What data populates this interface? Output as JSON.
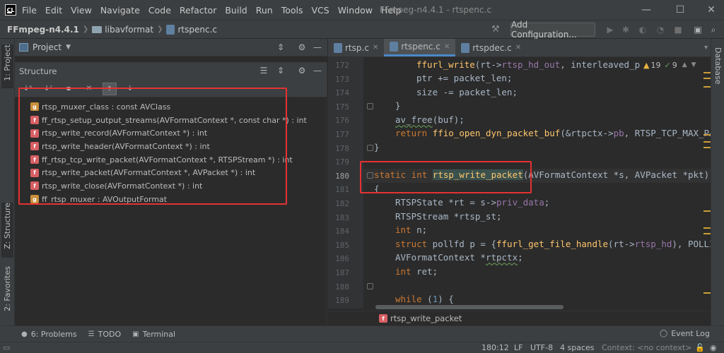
{
  "app": {
    "logo": "CL",
    "window_title": "FFmpeg-n4.4.1 - rtspenc.c",
    "menu": [
      "File",
      "Edit",
      "View",
      "Navigate",
      "Code",
      "Refactor",
      "Build",
      "Run",
      "Tools",
      "VCS",
      "Window",
      "Help"
    ]
  },
  "nav": {
    "project": "FFmpeg-n4.4.1",
    "folder": "libavformat",
    "file": "rtspenc.c",
    "config_button": "Add Configuration..."
  },
  "left_tools": {
    "project_tab": "1: Project",
    "structure_tab": "Z: Structure",
    "favorites_tab": "2: Favorites"
  },
  "right_tools": {
    "database_tab": "Database"
  },
  "project_panel": {
    "title": "Project"
  },
  "structure": {
    "title": "Structure",
    "items": [
      {
        "badge": "g",
        "label": "rtsp_muxer_class : const AVClass"
      },
      {
        "badge": "f",
        "label": "ff_rtsp_setup_output_streams(AVFormatContext *, const char *) : int"
      },
      {
        "badge": "f",
        "label": "rtsp_write_record(AVFormatContext *) : int"
      },
      {
        "badge": "f",
        "label": "rtsp_write_header(AVFormatContext *) : int"
      },
      {
        "badge": "f",
        "label": "ff_rtsp_tcp_write_packet(AVFormatContext *, RTSPStream *) : int"
      },
      {
        "badge": "f",
        "label": "rtsp_write_packet(AVFormatContext *, AVPacket *) : int"
      },
      {
        "badge": "f",
        "label": "rtsp_write_close(AVFormatContext *) : int"
      },
      {
        "badge": "g",
        "label": "ff_rtsp_muxer : AVOutputFormat"
      }
    ]
  },
  "tabs": [
    {
      "label": "rtsp.c"
    },
    {
      "label": "rtspenc.c"
    },
    {
      "label": "rtspdec.c"
    }
  ],
  "inspections": {
    "warnings": "19",
    "ok": "9"
  },
  "editor": {
    "line_numbers": [
      "172",
      "173",
      "174",
      "175",
      "176",
      "177",
      "178",
      "179",
      "180",
      "181",
      "182",
      "183",
      "184",
      "185",
      "186",
      "187",
      "188",
      "189"
    ],
    "current_line": "180"
  },
  "code_breadcrumb": "rtsp_write_packet",
  "bottom_tools": {
    "problems": "6: Problems",
    "todo": "TODO",
    "terminal": "Terminal",
    "event_log": "Event Log"
  },
  "status": {
    "position": "180:12",
    "line_sep": "LF",
    "encoding": "UTF-8",
    "indent": "4 spaces",
    "context": "Context: <no context>"
  }
}
